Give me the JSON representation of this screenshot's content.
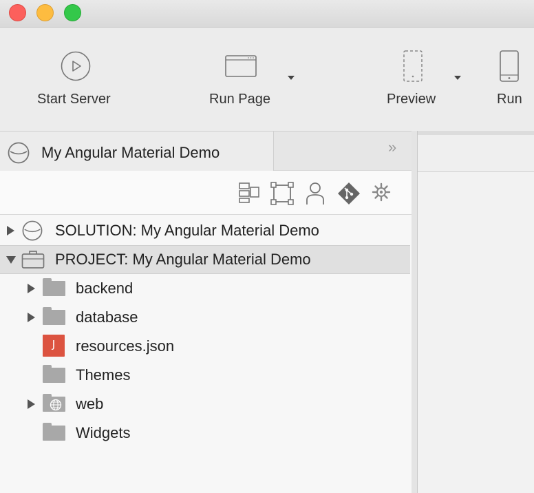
{
  "toolbar": {
    "start_server": "Start Server",
    "run_page": "Run Page",
    "preview": "Preview",
    "run": "Run"
  },
  "panel": {
    "tab_title": "My Angular Material Demo",
    "collapse_glyph": "»"
  },
  "tree": {
    "solution": "SOLUTION: My Angular Material Demo",
    "project": "PROJECT: My Angular Material Demo",
    "items": [
      {
        "label": "backend",
        "type": "folder",
        "expandable": true
      },
      {
        "label": "database",
        "type": "folder",
        "expandable": true
      },
      {
        "label": "resources.json",
        "type": "json-file",
        "expandable": false,
        "badge": "J"
      },
      {
        "label": "Themes",
        "type": "folder",
        "expandable": false
      },
      {
        "label": "web",
        "type": "web-folder",
        "expandable": true
      },
      {
        "label": "Widgets",
        "type": "folder",
        "expandable": false
      }
    ]
  },
  "colors": {
    "json_badge": "#dc5340",
    "folder": "#a8a8a8",
    "close": "#fc605c",
    "minimize": "#fdbc40",
    "zoom": "#34c84a"
  }
}
